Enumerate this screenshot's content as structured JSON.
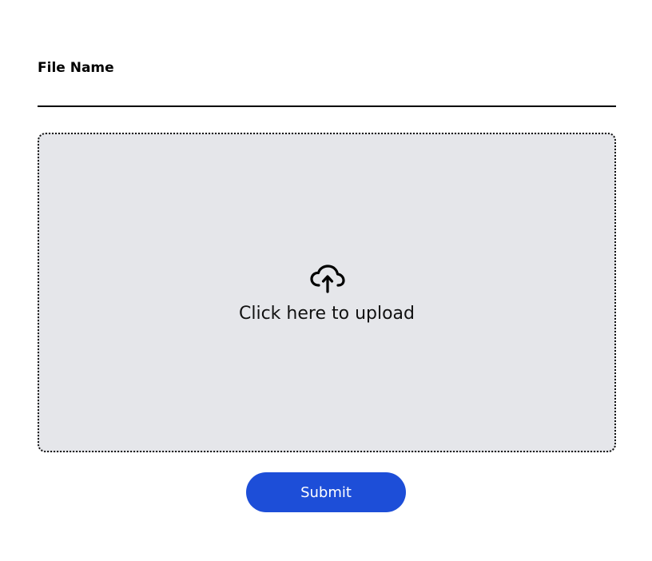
{
  "form": {
    "file_name_label": "File Name",
    "file_name_value": "",
    "file_name_placeholder": ""
  },
  "dropzone": {
    "icon": "cloud-upload-icon",
    "text": "Click here to upload",
    "background_color": "#e5e6ea"
  },
  "submit": {
    "label": "Submit",
    "color": "#1d4ed8"
  }
}
